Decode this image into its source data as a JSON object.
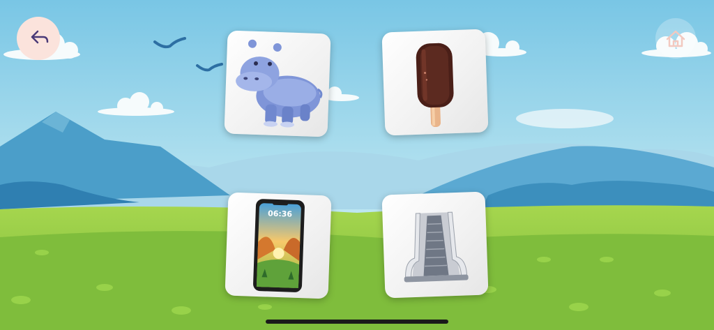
{
  "game": {
    "back_button": {
      "icon": "back-arrow-icon"
    },
    "home_button": {
      "icon": "home-icon"
    },
    "cards": [
      {
        "icon": "hippo-icon"
      },
      {
        "icon": "ice-pop-icon"
      },
      {
        "icon": "smartphone-icon",
        "screen_time": "06:36"
      },
      {
        "icon": "escalator-icon"
      }
    ]
  },
  "colors": {
    "sky_top": "#7ec9e6",
    "sky_bottom": "#cdeef5",
    "mountain_far": "#4a9fc8",
    "grass": "#8cc63f",
    "back_button_bg": "#fbe3dc",
    "back_arrow": "#4a3a78"
  }
}
